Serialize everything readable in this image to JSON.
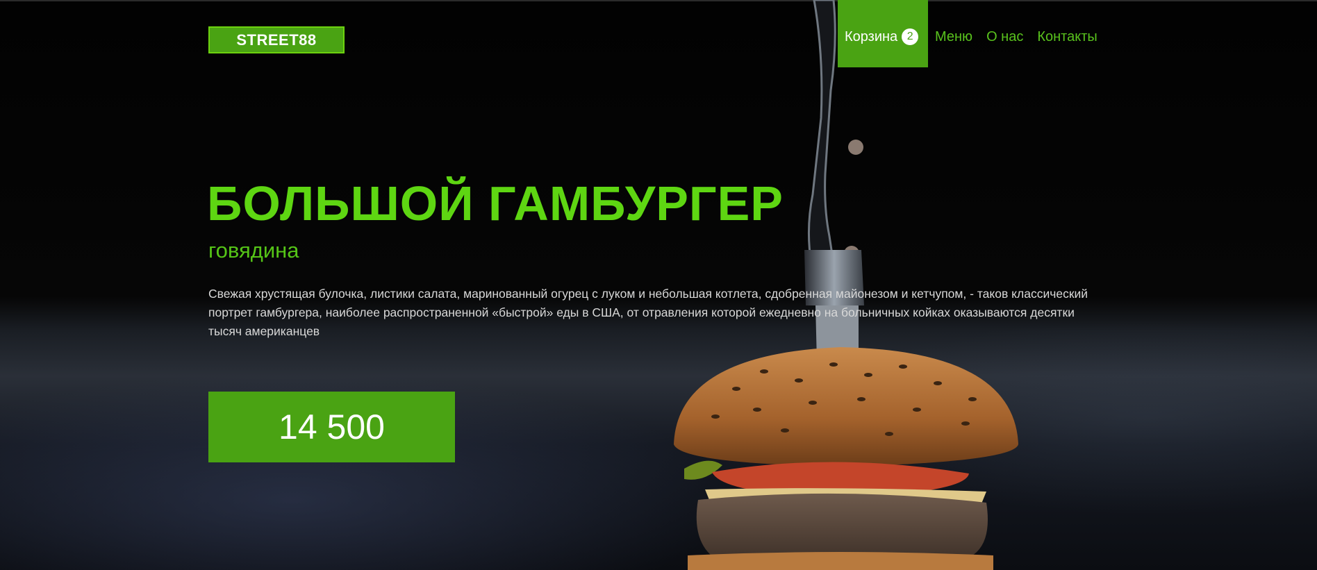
{
  "header": {
    "logo": "STREET88",
    "nav": {
      "cart_label": "Корзина",
      "cart_count": "2",
      "items": [
        "Меню",
        "О нас",
        "Контакты"
      ]
    }
  },
  "hero": {
    "title": "БОЛЬШОЙ ГАМБУРГЕР",
    "subtitle": "говядина",
    "description": "Свежая хрустящая булочка, листики салата, маринованный огурец с луком и небольшая котлета, сдобренная майонезом и кетчупом, - таков классический портрет гамбургера, наиболее распространенной «быстрой» еды в США, от отравления которой ежедневно на больничных койках оказываются десятки тысяч американцев",
    "price": "14 500"
  },
  "colors": {
    "accent": "#4aa313",
    "accent_text": "#5ed612",
    "background": "#050505"
  },
  "icons": {
    "background_photo": "burger-with-knife-photo"
  }
}
